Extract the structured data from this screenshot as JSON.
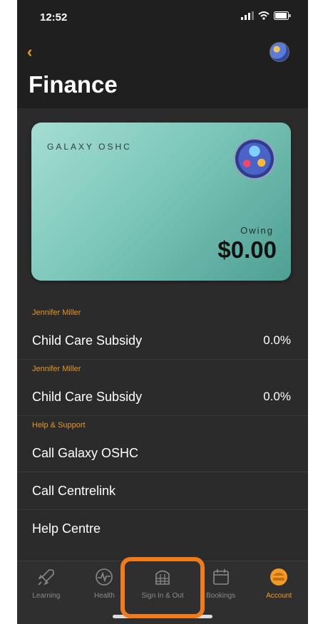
{
  "status_bar": {
    "time": "12:52"
  },
  "header": {
    "back_icon": "chevron-left-icon",
    "title": "Finance"
  },
  "card": {
    "brand": "GALAXY OSHC",
    "owing_label": "Owing",
    "owing_amount": "$0.00"
  },
  "sections": [
    {
      "label": "Jennifer Miller",
      "rows": [
        {
          "label": "Child Care Subsidy",
          "value": "0.0%"
        }
      ]
    },
    {
      "label": "Jennifer Miller",
      "rows": [
        {
          "label": "Child Care Subsidy",
          "value": "0.0%"
        }
      ]
    },
    {
      "label": "Help & Support",
      "rows": [
        {
          "label": "Call Galaxy OSHC",
          "value": ""
        },
        {
          "label": "Call Centrelink",
          "value": ""
        },
        {
          "label": "Help Centre",
          "value": ""
        }
      ]
    }
  ],
  "tabs": [
    {
      "label": "Learning",
      "icon": "rocket-icon",
      "active": false
    },
    {
      "label": "Health",
      "icon": "heartbeat-icon",
      "active": false
    },
    {
      "label": "Sign In & Out",
      "icon": "building-icon",
      "active": false
    },
    {
      "label": "Bookings",
      "icon": "calendar-icon",
      "active": false
    },
    {
      "label": "Account",
      "icon": "account-icon",
      "active": true
    }
  ],
  "colors": {
    "accent": "#f29a28",
    "highlight": "#ef7b1d",
    "background": "#2b2b2b"
  }
}
